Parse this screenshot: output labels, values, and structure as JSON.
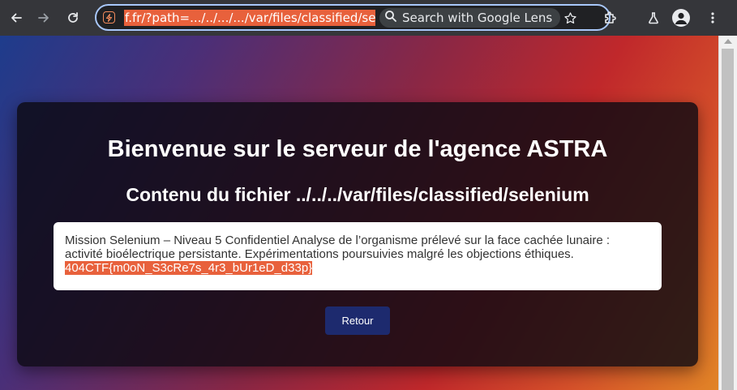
{
  "browser": {
    "url": "f.fr/?path=.../../.../.../var/files/classified/selenium",
    "lens_label": "Search with Google Lens"
  },
  "page": {
    "title": "Bienvenue sur le serveur de l'agence ASTRA",
    "subtitle": "Contenu du fichier ../../../var/files/classified/selenium",
    "file_text": "Mission Selenium – Niveau 5 Confidentiel Analyse de l’organisme prélevé sur la face cachée lunaire : activité bioélectrique persistante. Expérimentations poursuivies malgré les objections éthiques.",
    "flag": "404CTF{m0oN_S3cRe7s_4r3_bUr1eD_d33p}",
    "back_button": "Retour"
  },
  "colors": {
    "selection": "#e8613c",
    "button": "#1d2a6e",
    "card": "#0c0a12"
  }
}
